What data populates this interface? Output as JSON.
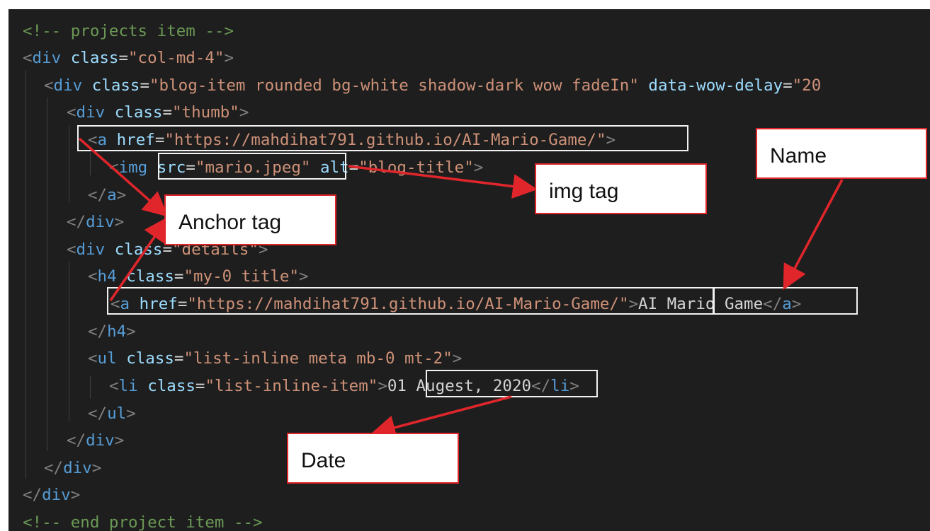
{
  "code": {
    "comment_start": "<!-- projects item -->",
    "comment_end": "<!-- end project item -->",
    "tag_div": "div",
    "tag_a": "a",
    "tag_img": "img",
    "tag_h4": "h4",
    "tag_ul": "ul",
    "tag_li": "li",
    "attr_class": "class",
    "attr_href": "href",
    "attr_src": "src",
    "attr_alt": "alt",
    "attr_data_wow": "data-wow-delay",
    "str_col": "\"col-md-4\"",
    "str_blog_item": "\"blog-item rounded bg-white shadow-dark wow fadeIn\"",
    "str_delay": "\"20",
    "str_thumb": "\"thumb\"",
    "str_href": "\"https://mahdihat791.github.io/AI-Mario-Game/\"",
    "str_src": "\"mario.jpeg\"",
    "str_alt": "\"blog-title\"",
    "str_details": "\"details\"",
    "str_title": "\"my-0 title\"",
    "link_text": "AI Mario Game",
    "str_list": "\"list-inline meta mb-0 mt-2\"",
    "str_list_item": "\"list-inline-item\"",
    "date_text": "01 Augest, 2020"
  },
  "annotations": {
    "anchor": "Anchor tag",
    "img": "img tag",
    "name": "Name",
    "date": "Date"
  },
  "colors": {
    "background": "#1e1e1e",
    "tag": "#569cd6",
    "attribute": "#9cdcfe",
    "string": "#ce9178",
    "comment": "#6a9955",
    "arrow": "#e0262b"
  }
}
